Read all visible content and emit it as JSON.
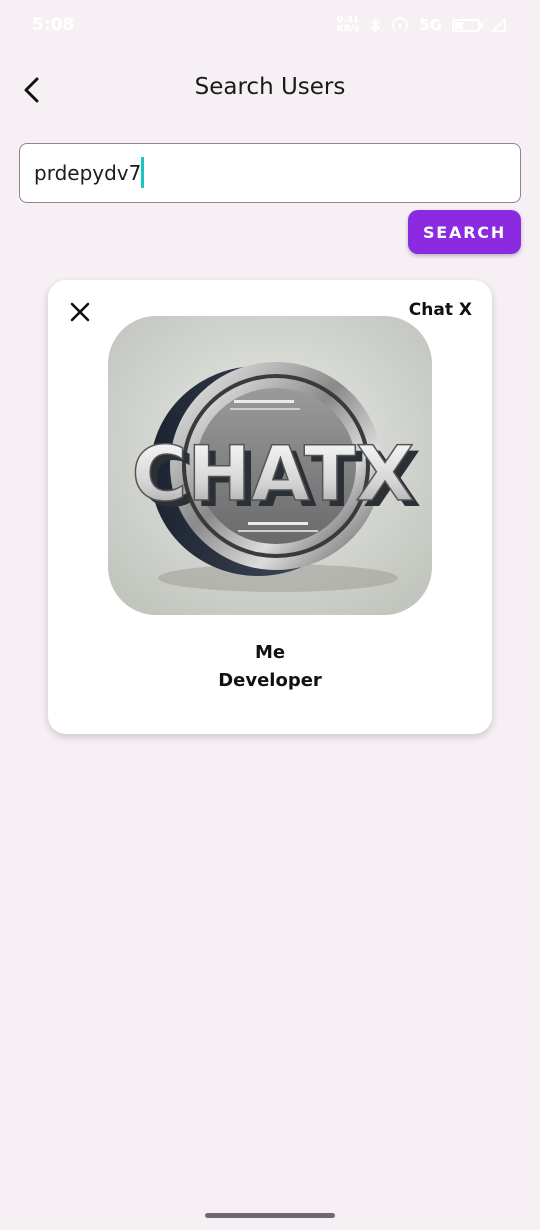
{
  "status_bar": {
    "time": "5:08",
    "speed_value": "0.31",
    "speed_unit": "KB/s",
    "network": "5G",
    "icons": [
      "bluetooth-icon",
      "hotspot-icon",
      "network-icon",
      "battery-icon",
      "signal-icon"
    ]
  },
  "header": {
    "title": "Search Users",
    "back_icon": "chevron-left-icon"
  },
  "search": {
    "value": "prdepydv7",
    "button_label": "SEARCH",
    "button_color": "#8a2be2",
    "caret_color": "#19c6c2"
  },
  "result_card": {
    "app_name": "Chat X",
    "close_icon": "close-icon",
    "avatar_text": "CHATX",
    "user_name": "Me",
    "user_role": "Developer"
  },
  "theme": {
    "background": "#f6f0f5",
    "card": "#ffffff"
  }
}
